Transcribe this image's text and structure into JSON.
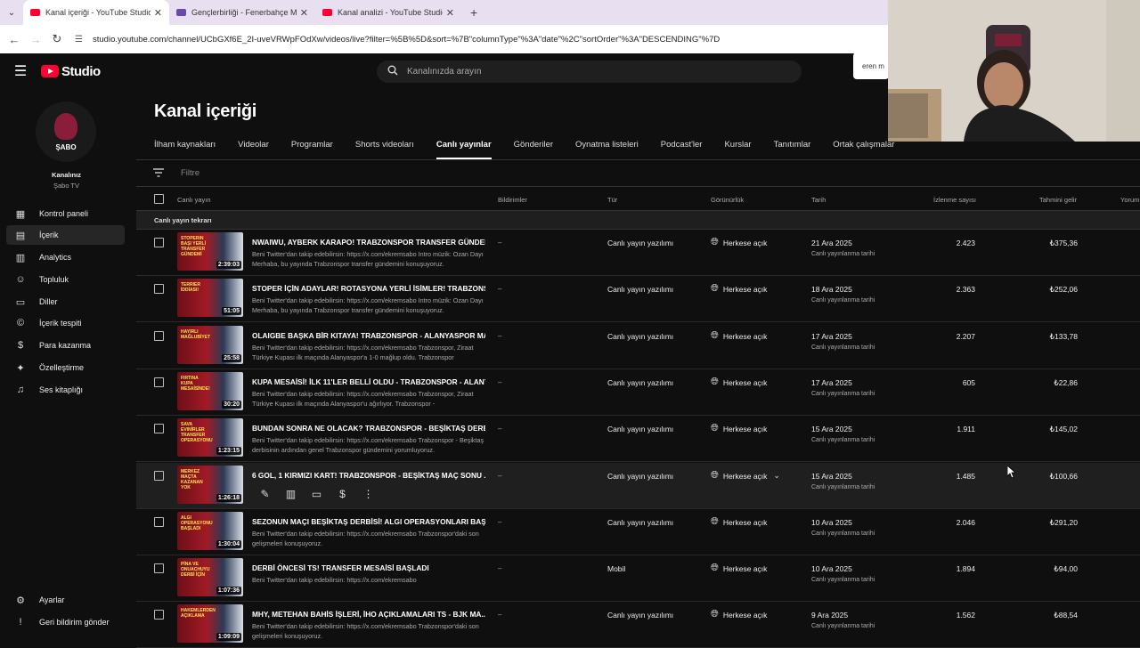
{
  "browser": {
    "tabs": [
      {
        "title": "Kanal içeriği - YouTube Studio",
        "favicon": "youtube-icon",
        "active": true
      },
      {
        "title": "Gençlerbirliği - Fenerbahçe Ma",
        "favicon": "fb-icon",
        "active": false
      },
      {
        "title": "Kanal analizi - YouTube Studio",
        "favicon": "youtube-icon",
        "active": false
      }
    ],
    "url": "studio.youtube.com/channel/UCbGXf6E_2I-uveVRWpFOdXw/videos/live?filter=%5B%5D&sort=%7B\"columnType\"%3A\"date\"%2C\"sortOrder\"%3A\"DESCENDING\"%7D"
  },
  "header": {
    "logo_text": "Studio",
    "search_placeholder": "Kanalınızda arayın",
    "tooltip": "eren m"
  },
  "sidebar": {
    "avatar_name": "ŞABO",
    "channel_label": "Kanalınız",
    "channel_name": "Şabo TV",
    "items": [
      {
        "label": "Kontrol paneli",
        "icon": "dashboard-icon"
      },
      {
        "label": "İçerik",
        "icon": "content-icon",
        "active": true
      },
      {
        "label": "Analytics",
        "icon": "analytics-icon"
      },
      {
        "label": "Topluluk",
        "icon": "community-icon"
      },
      {
        "label": "Diller",
        "icon": "subtitles-icon"
      },
      {
        "label": "İçerik tespiti",
        "icon": "copyright-icon"
      },
      {
        "label": "Para kazanma",
        "icon": "monetization-icon"
      },
      {
        "label": "Özelleştirme",
        "icon": "customization-icon"
      },
      {
        "label": "Ses kitaplığı",
        "icon": "audio-library-icon"
      }
    ],
    "bottom": [
      {
        "label": "Ayarlar",
        "icon": "gear-icon"
      },
      {
        "label": "Geri bildirim gönder",
        "icon": "feedback-icon"
      }
    ]
  },
  "main": {
    "title": "Kanal içeriği",
    "tabs": [
      "İlham kaynakları",
      "Videolar",
      "Programlar",
      "Shorts videoları",
      "Canlı yayınlar",
      "Gönderiler",
      "Oynatma listeleri",
      "Podcast'ler",
      "Kurslar",
      "Tanıtımlar",
      "Ortak çalışmalar"
    ],
    "active_tab": "Canlı yayınlar",
    "filter_placeholder": "Filtre",
    "columns": {
      "video": "Canlı yayın",
      "notifications": "Bildirimler",
      "type": "Tür",
      "visibility": "Görünürlük",
      "date": "Tarih",
      "views": "İzlenme sayısı",
      "revenue": "Tahmini gelir",
      "comments": "Yorum"
    },
    "section_label": "Canlı yayın tekrarı",
    "rows": [
      {
        "thumb_text": "STOPERIN BAŞI YERLİ TRANSFER GÜNDEMİ",
        "duration": "2:39:03",
        "title": "NWAIWU, AYBERK KARAPO! TRABZONSPOR TRANSFER GÜNDEMİ",
        "desc": "Beni Twitter'dan takip edebilirsin: https://x.com/ekremsabo Intro müzik: Ozan Dayı Merhaba, bu yayında Trabzonspor transfer gündemini konuşuyoruz.",
        "notif": "–",
        "type": "Canlı yayın yazılımı",
        "visibility": "Herkese açık",
        "date": "21 Ara 2025",
        "date_sub": "Canlı yayınlanma tarihi",
        "views": "2.423",
        "revenue": "₺375,36"
      },
      {
        "thumb_text": "TERRIER İDDİASI!",
        "duration": "51:05",
        "title": "STOPER İÇİN ADAYLAR! ROTASYONA YERLİ İSİMLER! TRABZONS...",
        "desc": "Beni Twitter'dan takip edebilirsin: https://x.com/ekremsabo Intro müzik: Ozan Dayı Merhaba, bu yayında Trabzonspor transfer gündemini konuşuyoruz.",
        "notif": "–",
        "type": "Canlı yayın yazılımı",
        "visibility": "Herkese açık",
        "date": "18 Ara 2025",
        "date_sub": "Canlı yayınlanma tarihi",
        "views": "2.363",
        "revenue": "₺252,06"
      },
      {
        "thumb_text": "HAYIRLI MAĞLUBİYET",
        "duration": "25:58",
        "title": "OLAIGBE BAŞKA BİR KITAYA! TRABZONSPOR - ALANYASPOR MA...",
        "desc": "Beni Twitter'dan takip edebilirsin: https://x.com/ekremsabo Trabzonspor, Ziraat Türkiye Kupası ilk maçında Alanyaspor'a 1-0 mağlup oldu. Trabzonspor",
        "notif": "–",
        "type": "Canlı yayın yazılımı",
        "visibility": "Herkese açık",
        "date": "17 Ara 2025",
        "date_sub": "Canlı yayınlanma tarihi",
        "views": "2.207",
        "revenue": "₺133,78"
      },
      {
        "thumb_text": "FIRTINA KUPA MESAİSİNDE!",
        "duration": "30:20",
        "title": "KUPA MESAİSİ! İLK 11'LER BELLİ OLDU - TRABZONSPOR - ALANY...",
        "desc": "Beni Twitter'dan takip edebilirsin: https://x.com/ekremsabo Trabzonspor, Ziraat Türkiye Kupası ilk maçında Alanyaspor'u ağırlıyor. Trabzonspor -",
        "notif": "–",
        "type": "Canlı yayın yazılımı",
        "visibility": "Herkese açık",
        "date": "17 Ara 2025",
        "date_sub": "Canlı yayınlanma tarihi",
        "views": "605",
        "revenue": "₺22,86"
      },
      {
        "thumb_text": "SAVA EVINİRLER TRANSFER OPERASYONU",
        "duration": "1:23:15",
        "title": "BUNDAN SONRA NE OLACAK? TRABZONSPOR - BEŞİKTAŞ DERBİ...",
        "desc": "Beni Twitter'dan takip edebilirsin: https://x.com/ekremsabo Trabzonspor - Beşiktaş derbisinin ardından genel Trabzonspor gündemini yorumluyoruz.",
        "notif": "–",
        "type": "Canlı yayın yazılımı",
        "visibility": "Herkese açık",
        "date": "15 Ara 2025",
        "date_sub": "Canlı yayınlanma tarihi",
        "views": "1.911",
        "revenue": "₺145,02"
      },
      {
        "thumb_text": "MERKEZ MAÇTA KAZANAN YOK",
        "duration": "1:26:18",
        "title": "6 GOL, 1 KIRMIZI KART! TRABZONSPOR - BEŞİKTAŞ MAÇ SONU ...",
        "desc": "",
        "notif": "–",
        "type": "Canlı yayın yazılımı",
        "visibility": "Herkese açık",
        "date": "15 Ara 2025",
        "date_sub": "Canlı yayınlanma tarihi",
        "views": "1.485",
        "revenue": "₺100,66",
        "hover": true
      },
      {
        "thumb_text": "ALGI OPERASYONU BAŞLADI",
        "duration": "1:30:04",
        "title": "SEZONUN MAÇI BEŞİKTAŞ DERBİSİ! ALGI OPERASYONLARI BAŞ...",
        "desc": "Beni Twitter'dan takip edebilirsin: https://x.com/ekremsabo Trabzonspor'daki son gelişmeleri konuşuyoruz.",
        "notif": "–",
        "type": "Canlı yayın yazılımı",
        "visibility": "Herkese açık",
        "date": "10 Ara 2025",
        "date_sub": "Canlı yayınlanma tarihi",
        "views": "2.046",
        "revenue": "₺291,20"
      },
      {
        "thumb_text": "PİNA VE ONUACHUYU DERBİ İÇİN",
        "duration": "1:07:36",
        "title": "DERBİ ÖNCESİ TS! TRANSFER MESAİSİ BAŞLADI",
        "desc": "Beni Twitter'dan takip edebilirsin: https://x.com/ekremsabo",
        "notif": "–",
        "type": "Mobil",
        "visibility": "Herkese açık",
        "date": "10 Ara 2025",
        "date_sub": "Canlı yayınlanma tarihi",
        "views": "1.894",
        "revenue": "₺94,00"
      },
      {
        "thumb_text": "HAKEMLERDEN AÇIKLAMA",
        "duration": "1:09:09",
        "title": "MHY, METEHAN BAHİS İŞLERİ, İHO AÇIKLAMALARI TS - BJK MA...",
        "desc": "Beni Twitter'dan takip edebilirsin: https://x.com/ekremsabo Trabzonspor'daki son gelişmeleri konuşuyoruz.",
        "notif": "–",
        "type": "Canlı yayın yazılımı",
        "visibility": "Herkese açık",
        "date": "9 Ara 2025",
        "date_sub": "Canlı yayınlanma tarihi",
        "views": "1.562",
        "revenue": "₺88,54"
      }
    ],
    "hover_actions": [
      "pencil-icon",
      "analytics-icon",
      "comments-icon",
      "monetization-icon",
      "more-icon"
    ]
  },
  "colors": {
    "brand": "#ff0033",
    "background": "#0f0f0f",
    "accent": "#ffffff"
  }
}
